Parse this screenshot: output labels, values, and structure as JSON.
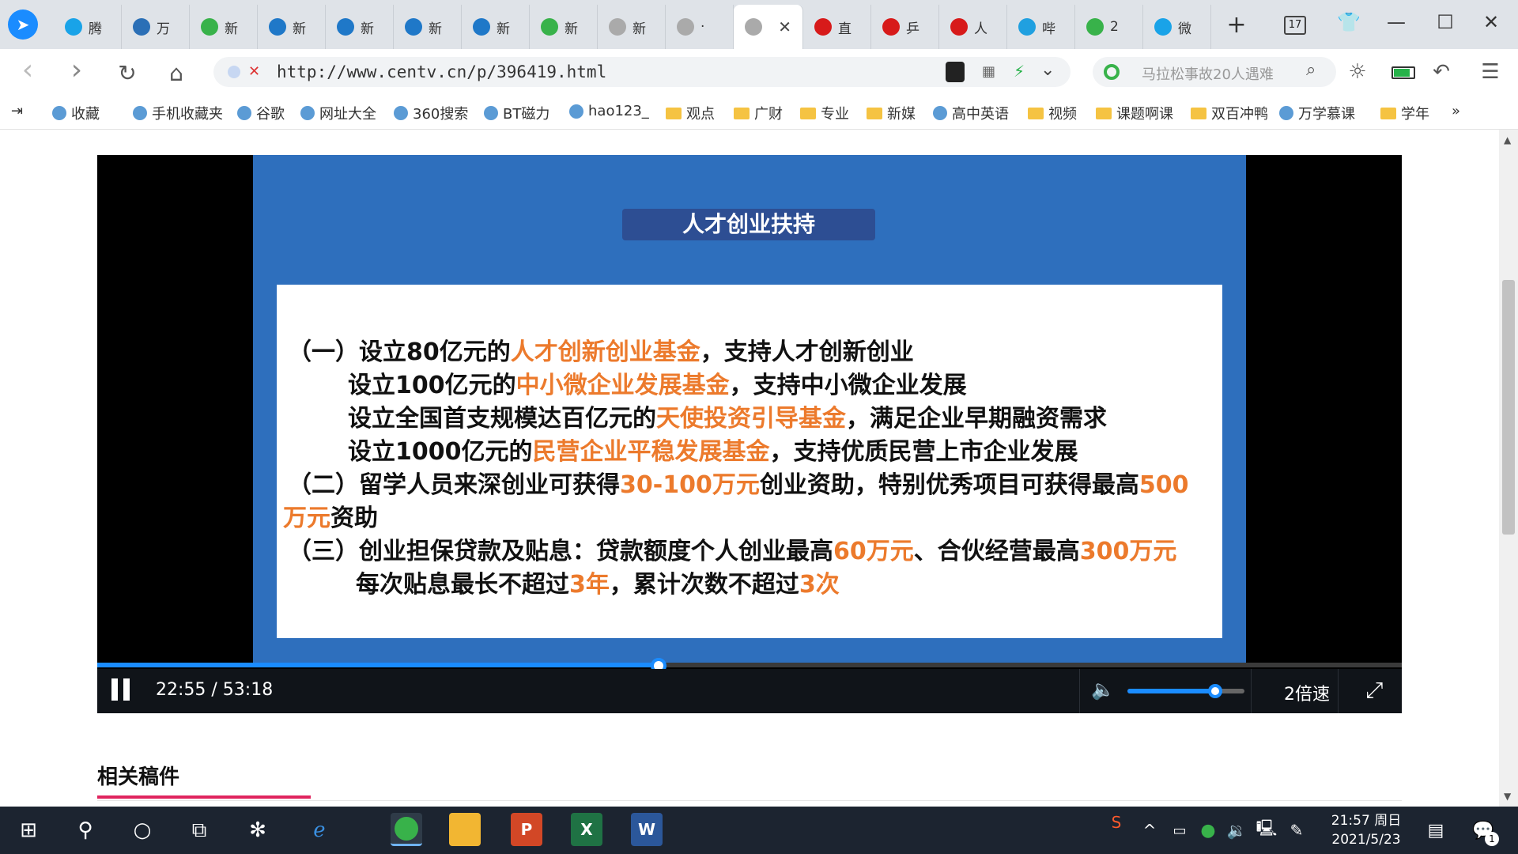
{
  "tabs": [
    {
      "label": "腾",
      "icon": "video-play-icon",
      "color": "#19a3e8"
    },
    {
      "label": "万",
      "icon": "globe-icon",
      "color": "#2b6fb6"
    },
    {
      "label": "新",
      "icon": "360-search-icon",
      "color": "#38b24a"
    },
    {
      "label": "新",
      "icon": "news-icon",
      "color": "#1f78c8"
    },
    {
      "label": "新",
      "icon": "news-icon",
      "color": "#1f78c8"
    },
    {
      "label": "新",
      "icon": "news-icon",
      "color": "#1f78c8"
    },
    {
      "label": "新",
      "icon": "news-icon",
      "color": "#1f78c8"
    },
    {
      "label": "新",
      "icon": "360-search-icon",
      "color": "#38b24a"
    },
    {
      "label": "新",
      "icon": "page-icon",
      "color": "#aaaaaa"
    },
    {
      "label": "·",
      "icon": "page-icon",
      "color": "#aaaaaa"
    },
    {
      "label": "",
      "icon": "page-icon",
      "color": "#aaaaaa"
    },
    {
      "label": "直",
      "icon": "cctv-icon",
      "color": "#d71a1a"
    },
    {
      "label": "乒",
      "icon": "dots-icon",
      "color": "#d71a1a"
    },
    {
      "label": "人",
      "icon": "play-red-icon",
      "color": "#d71a1a"
    },
    {
      "label": "哔",
      "icon": "bilibili-icon",
      "color": "#20a0e0"
    },
    {
      "label": "2",
      "icon": "360-search-icon",
      "color": "#38b24a"
    },
    {
      "label": "微",
      "icon": "video-play-icon",
      "color": "#19a3e8"
    }
  ],
  "window": {
    "tab_count": "17",
    "new_tab": "+",
    "minimize": "—",
    "maximize": "☐",
    "close": "✕"
  },
  "nav": {
    "back": "‹",
    "forward": "›",
    "reload": "↻",
    "home": "⌂",
    "url": "http://www.centv.cn/p/396419.html",
    "search_placeholder": "马拉松事故20人遇难"
  },
  "bookmarks": [
    {
      "label": "收藏",
      "icon": "star-icon"
    },
    {
      "label": "手机收藏夹",
      "icon": "phone-icon"
    },
    {
      "label": "谷歌",
      "icon": "page-icon"
    },
    {
      "label": "网址大全",
      "icon": "plus-circle-icon"
    },
    {
      "label": "360搜索",
      "icon": "360-search-icon"
    },
    {
      "label": "BT磁力",
      "icon": "bt-icon"
    },
    {
      "label": "hao123_",
      "icon": "hao-icon"
    },
    {
      "label": "观点",
      "icon": "folder-icon"
    },
    {
      "label": "广财",
      "icon": "folder-icon"
    },
    {
      "label": "专业",
      "icon": "folder-icon"
    },
    {
      "label": "新媒",
      "icon": "folder-icon"
    },
    {
      "label": "高中英语",
      "icon": "paw-icon"
    },
    {
      "label": "视频",
      "icon": "folder-icon"
    },
    {
      "label": "课题啊课",
      "icon": "folder-icon"
    },
    {
      "label": "双百冲鸭",
      "icon": "folder-icon"
    },
    {
      "label": "万学慕课",
      "icon": "globe-icon"
    },
    {
      "label": "学年",
      "icon": "folder-icon"
    }
  ],
  "bookmarks_more": "»",
  "slide": {
    "title": "人才创业扶持",
    "lines": [
      {
        "parts": [
          "（一）设立80亿元的",
          "人才创新创业基金",
          "，支持人才创新创业"
        ]
      },
      {
        "parts": [
          "设立100亿元的",
          "中小微企业发展基金",
          "，支持中小微企业发展"
        ]
      },
      {
        "parts": [
          "设立全国首支规模达百亿元的",
          "天使投资引导基金",
          "，满足企业早期融资需求"
        ]
      },
      {
        "parts": [
          "设立1000亿元的",
          "民营企业平稳发展基金",
          "，支持优质民营上市企业发展"
        ]
      },
      {
        "parts": [
          "（二）留学人员来深创业可获得",
          "30-100万元",
          "创业资助，特别优秀项目可获得最高",
          "500"
        ]
      },
      {
        "parts": [
          "万元",
          "资助"
        ]
      },
      {
        "parts": [
          "（三）创业担保贷款及贴息：贷款额度个人创业最高",
          "60万元",
          "、合伙经营最高",
          "300万元"
        ]
      },
      {
        "parts": [
          "每次贴息最长不超过",
          "3年",
          "，累计次数不超过",
          "3次"
        ]
      }
    ]
  },
  "player": {
    "time": "22:55 / 53:18",
    "progress": 0.43,
    "volume": 0.75,
    "speed": "2倍速"
  },
  "related": {
    "title": "相关稿件"
  },
  "taskbar": {
    "time": "21:57 周日",
    "date": "2021/5/23",
    "notif_count": "1"
  }
}
